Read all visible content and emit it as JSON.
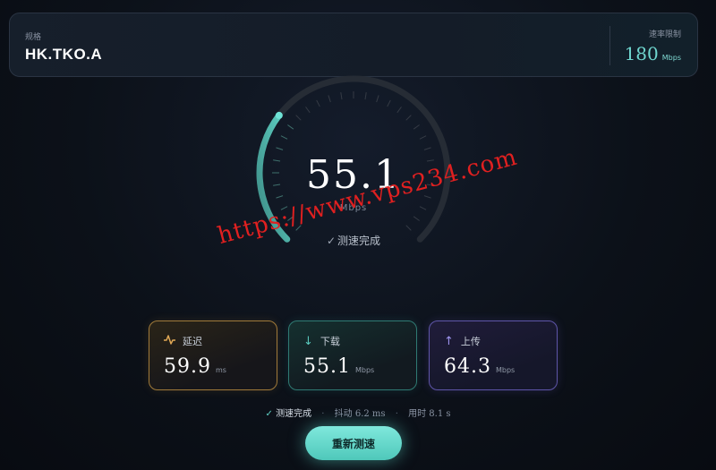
{
  "header": {
    "spec_label": "规格",
    "spec_value": "HK.TKO.A",
    "limit_label": "速率限制",
    "limit_value": "180",
    "limit_unit": "Mbps"
  },
  "gauge": {
    "value": "55.1",
    "unit": "Mbps",
    "status": "测速完成",
    "fraction": 0.306
  },
  "metrics": {
    "latency": {
      "label": "延迟",
      "value": "59.9",
      "unit": "ms",
      "icon": "pulse-icon"
    },
    "download": {
      "label": "下载",
      "value": "55.1",
      "unit": "Mbps",
      "icon": "arrow-down-icon"
    },
    "upload": {
      "label": "上传",
      "value": "64.3",
      "unit": "Mbps",
      "icon": "arrow-up-icon"
    }
  },
  "summary": {
    "status": "测速完成",
    "jitter_label": "抖动",
    "jitter_value": "6.2 ms",
    "time_label": "用时",
    "time_value": "8.1 s"
  },
  "actions": {
    "retest_label": "重新测速"
  },
  "watermark": "https://www.vps234.com",
  "colors": {
    "accent": "#4fc8ba",
    "latency": "#e0a855",
    "download": "#59c9bd",
    "upload": "#9f95f0"
  }
}
